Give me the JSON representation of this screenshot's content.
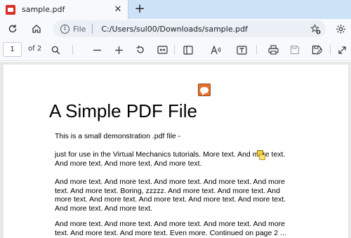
{
  "tab": {
    "title": "sample.pdf",
    "close": "✕",
    "new_tab": "+"
  },
  "address": {
    "scheme": "File",
    "url": "C:/Users/sul00/Downloads/sample.pdf"
  },
  "pdf_toolbar": {
    "page_number": "1",
    "page_count_label": "of 2"
  },
  "document": {
    "title": "A Simple PDF File",
    "paragraphs": [
      "This is a small demonstration .pdf file -",
      "just for use in the Virtual Mechanics tutorials. More text. And more text. And more text. And more text. And more text.",
      "And more text. And more text. And more text. And more text. And more text. And more text. Boring, zzzzz. And more text. And more text. And more text. And more text. And more text. And more text. And more text. And more text. And more text.",
      "And more text. And more text. And more text. And more text. And more text. And more text. And more text. Even more. Continued on page 2 ..."
    ]
  },
  "icons": {
    "tab": "pdf-file-icon",
    "nav": [
      "refresh-icon",
      "home-icon",
      "info-icon",
      "favorites-add-icon",
      "settings-icon"
    ],
    "toolbar": [
      "search-icon",
      "zoom-out-icon",
      "zoom-in-icon",
      "rotate-icon",
      "fit-page-icon",
      "page-view-icon",
      "read-aloud-icon",
      "text-icon",
      "print-icon",
      "save-icon",
      "save-as-icon",
      "fullscreen-icon"
    ],
    "annotations": [
      "comment-note-icon",
      "note-icon"
    ]
  },
  "colors": {
    "accent": "#cde1f7",
    "note": "#e8712b"
  }
}
